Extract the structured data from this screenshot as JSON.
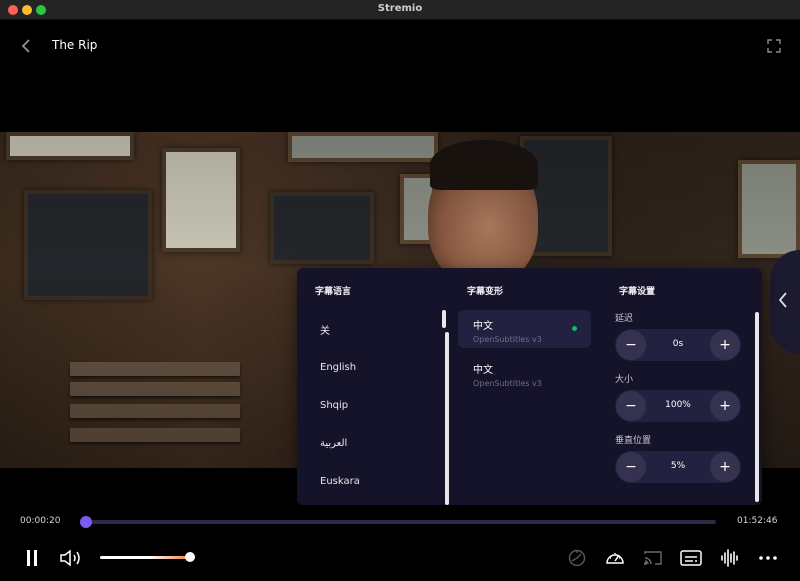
{
  "window": {
    "title": "Stremio"
  },
  "player": {
    "title": "The Rip"
  },
  "subtitles": {
    "headers": {
      "language": "字幕语言",
      "variants": "字幕变形",
      "settings": "字幕设置"
    },
    "languages": [
      {
        "label": "关"
      },
      {
        "label": "English"
      },
      {
        "label": "Shqip"
      },
      {
        "label": "العربية"
      },
      {
        "label": "Euskara"
      }
    ],
    "variants": [
      {
        "name": "中文",
        "source": "OpenSubtitles v3",
        "selected": true
      },
      {
        "name": "中文",
        "source": "OpenSubtitles v3",
        "selected": false
      }
    ],
    "settings": [
      {
        "label": "延迟",
        "value": "0s"
      },
      {
        "label": "大小",
        "value": "100%"
      },
      {
        "label": "垂直位置",
        "value": "5%"
      }
    ],
    "minus_symbol": "−",
    "plus_symbol": "+"
  },
  "timeline": {
    "current": "00:00:20",
    "total": "01:52:46",
    "progress": 0.003
  },
  "volume": {
    "level": 0.95
  },
  "colors": {
    "accent": "#7b5bf5",
    "panel": "#15132a",
    "selected_dot": "#22b365",
    "volume_end": "#f07b3a"
  },
  "icons": [
    "chevron-left-icon",
    "fullscreen-icon",
    "chevron-left-icon",
    "pause-icon",
    "volume-icon",
    "speed-icon",
    "gauge-icon",
    "cast-icon",
    "subtitles-icon",
    "audio-waveform-icon",
    "more-icon"
  ]
}
